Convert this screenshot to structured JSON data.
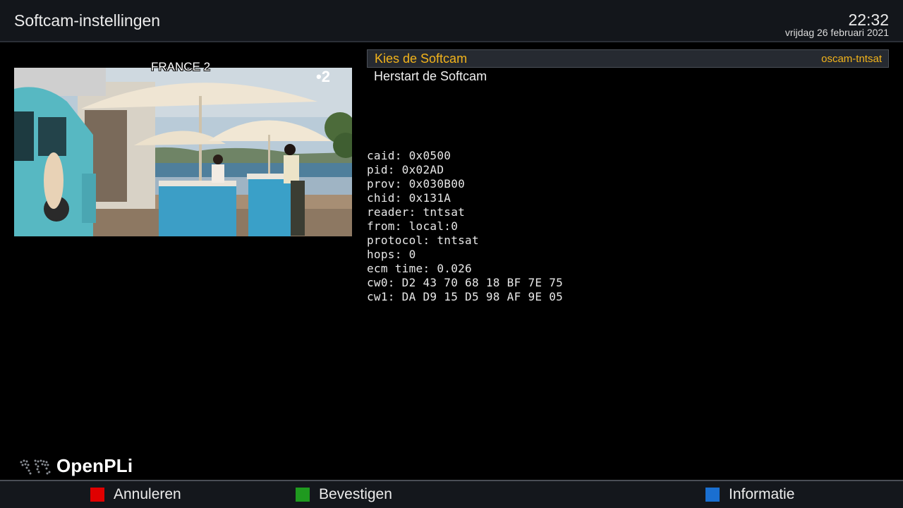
{
  "header": {
    "title": "Softcam-instellingen",
    "time": "22:32",
    "date": "vrijdag 26 februari 2021"
  },
  "preview": {
    "channel_name": "FRANCE 2",
    "channel_logo": "•2"
  },
  "menu": {
    "items": [
      {
        "label": "Kies de Softcam",
        "value": "oscam-tntsat",
        "selected": true
      },
      {
        "label": "Herstart de Softcam",
        "value": "",
        "selected": false
      }
    ]
  },
  "ecm_info": {
    "lines": [
      "caid: 0x0500",
      "pid: 0x02AD",
      "prov: 0x030B00",
      "chid: 0x131A",
      "reader: tntsat",
      "from: local:0",
      "protocol: tntsat",
      "hops: 0",
      "ecm time: 0.026",
      "cw0: D2 43 70 68 18 BF 7E 75",
      "cw1: DA D9 15 D5 98 AF 9E 05"
    ]
  },
  "brand": {
    "name": "OpenPLi"
  },
  "footer": {
    "keys": [
      {
        "label": "Annuleren",
        "color": "#e00000"
      },
      {
        "label": "Bevestigen",
        "color": "#1f9a1f"
      },
      {
        "label": "Informatie",
        "color": "#1a6fd1"
      }
    ]
  },
  "colors": {
    "accent": "#f3b41b",
    "header_bg": "#13161b",
    "background": "#000000"
  }
}
